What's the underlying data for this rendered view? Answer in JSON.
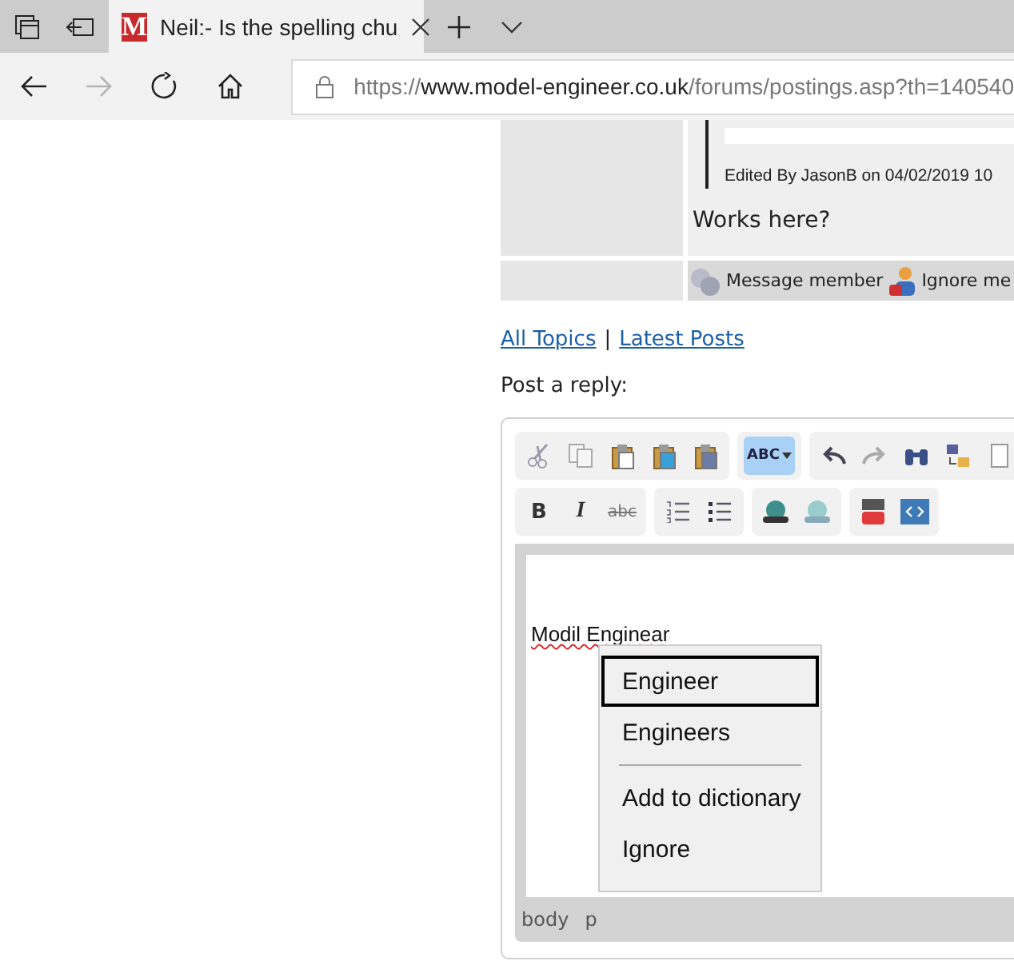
{
  "browser": {
    "tab": {
      "favicon": "M",
      "title": "Neil:- Is the spelling chu",
      "selected": true
    },
    "nav": {
      "forward_disabled": true
    },
    "address": {
      "scheme": "https://",
      "host": "www.model-engineer.co.uk",
      "path": "/forums/postings.asp?th=140540"
    }
  },
  "post": {
    "edited": "Edited By JasonB on 04/02/2019 10",
    "body": "Works here?",
    "actions": [
      "Message member",
      "Ignore me"
    ]
  },
  "links": [
    {
      "label": "All Topics"
    },
    {
      "label": "Latest Posts"
    }
  ],
  "separator": "|",
  "reply_heading": "Post a reply:",
  "editor": {
    "spell_glyph": "ABC",
    "spellcheck_on": true,
    "format_glyphs": [
      "B",
      "I",
      "abc"
    ],
    "content": {
      "text": "Modil Enginear",
      "misspelled": true
    },
    "path": [
      "body",
      "p"
    ]
  },
  "context_menu": [
    {
      "kind": "item",
      "label": "Engineer",
      "selected": true
    },
    {
      "kind": "item",
      "label": "Engineers",
      "selected": false
    },
    {
      "kind": "separator"
    },
    {
      "kind": "item",
      "label": "Add to dictionary",
      "selected": false
    },
    {
      "kind": "item",
      "label": "Ignore",
      "selected": false
    }
  ]
}
